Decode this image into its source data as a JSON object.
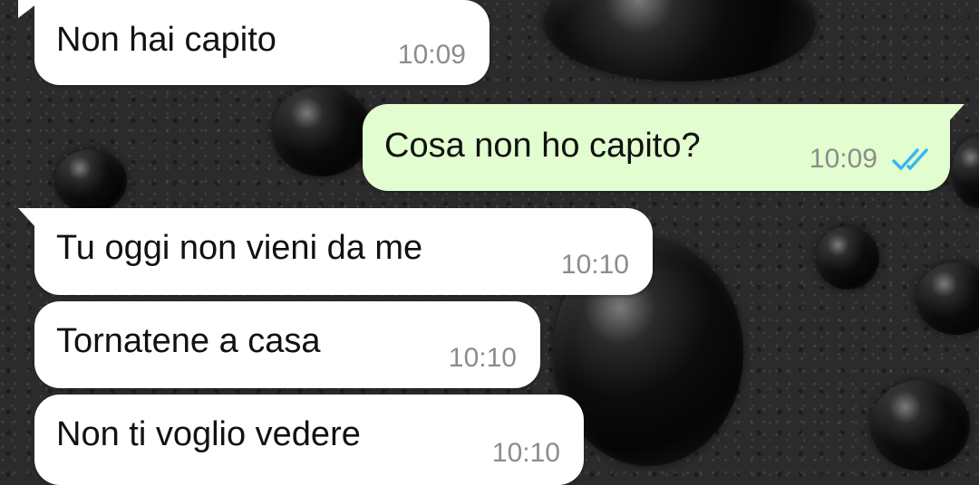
{
  "chat": {
    "messages": [
      {
        "direction": "incoming",
        "text": "Non hai capito",
        "time": "10:09"
      },
      {
        "direction": "outgoing",
        "text": "Cosa non ho capito?",
        "time": "10:09",
        "status_icon": "double-check-read-icon"
      },
      {
        "direction": "incoming",
        "text": "Tu oggi non vieni da me",
        "time": "10:10"
      },
      {
        "direction": "incoming",
        "text": "Tornatene a casa",
        "time": "10:10"
      },
      {
        "direction": "incoming",
        "text": "Non ti voglio vedere",
        "time": "10:10"
      }
    ]
  },
  "colors": {
    "incoming_bubble": "#ffffff",
    "outgoing_bubble": "#e2fdcf",
    "read_ticks": "#34b7f1",
    "timestamp": "#8c8c8c"
  }
}
